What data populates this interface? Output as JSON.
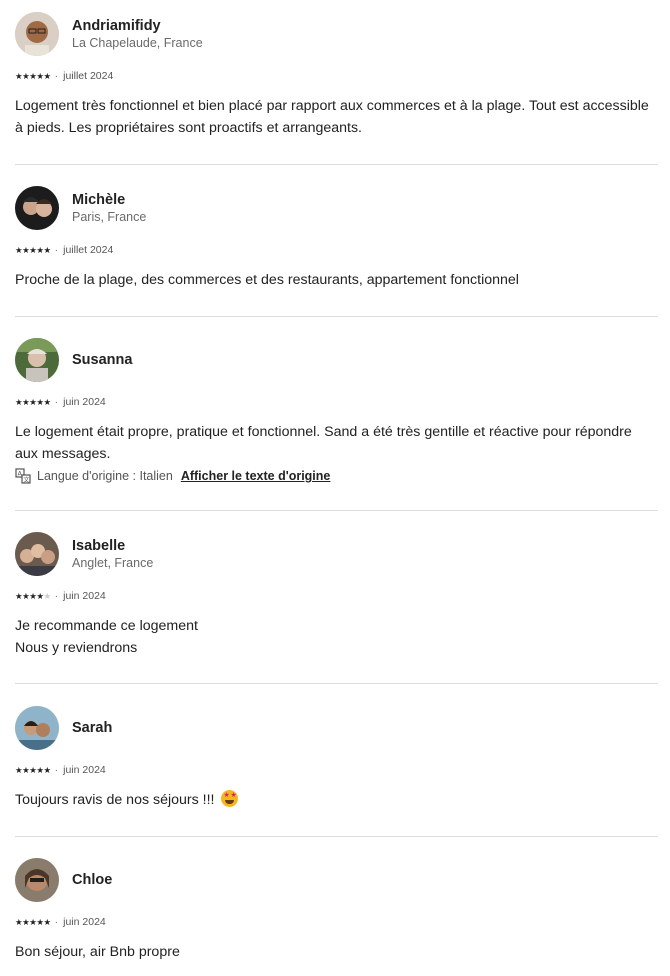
{
  "reviews": [
    {
      "name": "Andriamifidy",
      "location": "La Chapelaude, France",
      "rating": 5,
      "date": "juillet 2024",
      "text": [
        "Logement très fonctionnel et bien placé par rapport aux commerces et à la plage. Tout est accessible à pieds. Les propriétaires sont proactifs et arrangeants."
      ]
    },
    {
      "name": "Michèle",
      "location": "Paris, France",
      "rating": 5,
      "date": "juillet 2024",
      "text": [
        "Proche de la plage, des commerces et des restaurants, appartement fonctionnel"
      ]
    },
    {
      "name": "Susanna",
      "location": "",
      "rating": 5,
      "date": "juin 2024",
      "text": [
        "Le logement était propre, pratique et fonctionnel. Sand a été très gentille et réactive pour répondre aux messages."
      ],
      "translation": {
        "language_label": "Langue d'origine : Italien",
        "show_original": "Afficher le texte d'origine"
      }
    },
    {
      "name": "Isabelle",
      "location": "Anglet, France",
      "rating": 4,
      "date": "juin 2024",
      "text": [
        "Je recommande ce logement",
        "Nous y reviendrons"
      ]
    },
    {
      "name": "Sarah",
      "location": "",
      "rating": 5,
      "date": "juin 2024",
      "text": [
        "Toujours ravis de nos séjours !!!"
      ],
      "emoji": "star-struck-emoji"
    },
    {
      "name": "Chloe",
      "location": "",
      "rating": 5,
      "date": "juin 2024",
      "text": [
        "Bon séjour, air Bnb propre"
      ]
    }
  ],
  "icons": {
    "star": "star-icon",
    "translate": "translate-icon"
  },
  "colors": {
    "text": "#222222",
    "secondary": "#6a6a6a",
    "divider": "#dddddd",
    "star_off": "#cccccc"
  }
}
